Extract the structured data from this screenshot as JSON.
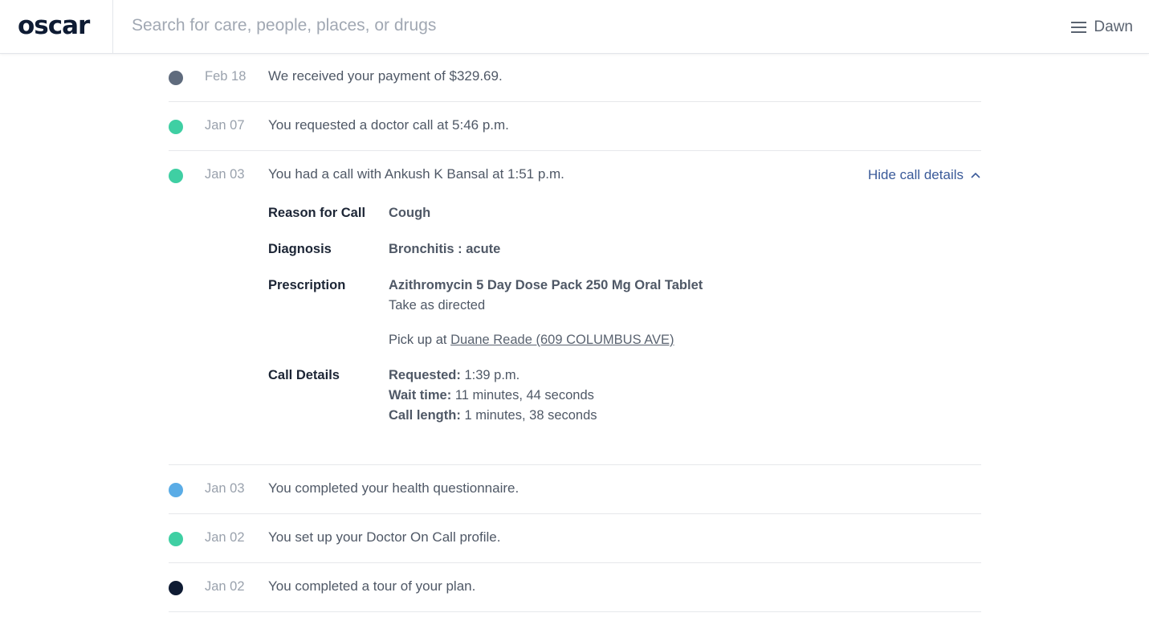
{
  "header": {
    "logo": "oscar",
    "search_placeholder": "Search for care, people, places, or drugs",
    "menu_icon": "hamburger-menu-icon",
    "user_name": "Dawn"
  },
  "colors": {
    "dot_gray": "#5f6b7d",
    "dot_green": "#3fcfa3",
    "dot_blue": "#5aace6",
    "dot_navy": "#0e1b33",
    "link_blue": "#3a5a99"
  },
  "timeline": [
    {
      "date": "Feb 18",
      "message": "We received your payment of $329.69.",
      "dot": "gray"
    },
    {
      "date": "Jan 07",
      "message": "You requested a doctor call at 5:46 p.m.",
      "dot": "green"
    },
    {
      "date": "Jan 03",
      "message": "You had a call with Ankush K Bansal at 1:51 p.m.",
      "dot": "green",
      "toggle_label": "Hide call details",
      "details": {
        "reason_label": "Reason for Call",
        "reason_value": "Cough",
        "diagnosis_label": "Diagnosis",
        "diagnosis_value": "Bronchitis : acute",
        "prescription_label": "Prescription",
        "prescription_drug": "Azithromycin 5 Day Dose Pack 250 Mg Oral Tablet",
        "prescription_instructions": "Take as directed",
        "pickup_prefix": "Pick up at",
        "pickup_pharmacy": "Duane Reade (609 COLUMBUS AVE)",
        "call_details_label": "Call Details",
        "requested_label": "Requested:",
        "requested_value": "1:39 p.m.",
        "wait_label": "Wait time:",
        "wait_value": "11 minutes, 44 seconds",
        "length_label": "Call length:",
        "length_value": "1 minutes, 38 seconds"
      }
    },
    {
      "date": "Jan 03",
      "message": "You completed your health questionnaire.",
      "dot": "blue"
    },
    {
      "date": "Jan 02",
      "message": "You set up your Doctor On Call profile.",
      "dot": "green"
    },
    {
      "date": "Jan 02",
      "message": "You completed a tour of your plan.",
      "dot": "navy"
    }
  ]
}
